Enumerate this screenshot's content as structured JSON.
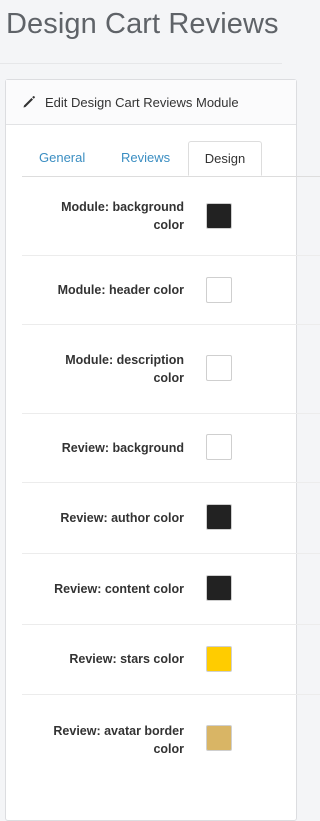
{
  "page": {
    "title": "Design Cart Reviews"
  },
  "panel": {
    "heading": "Edit Design Cart Reviews Module",
    "heading_icon": "pencil-icon"
  },
  "tabs": [
    {
      "label": "General",
      "active": false
    },
    {
      "label": "Reviews",
      "active": false
    },
    {
      "label": "Design",
      "active": true
    }
  ],
  "fields": [
    {
      "label_lines": [
        "Module: background",
        "color"
      ],
      "color": "#222222"
    },
    {
      "label_lines": [
        "Module: header color"
      ],
      "color": "#ffffff"
    },
    {
      "label_lines": [
        "Module: description",
        "color"
      ],
      "color": "#ffffff"
    },
    {
      "label_lines": [
        "Review: background"
      ],
      "color": "#ffffff"
    },
    {
      "label_lines": [
        "Review: author color"
      ],
      "color": "#222222"
    },
    {
      "label_lines": [
        "Review: content color"
      ],
      "color": "#222222"
    },
    {
      "label_lines": [
        "Review: stars color"
      ],
      "color": "#ffcc00"
    },
    {
      "label_lines": [
        "Review: avatar border",
        "color"
      ],
      "color": "#d9b565"
    }
  ]
}
